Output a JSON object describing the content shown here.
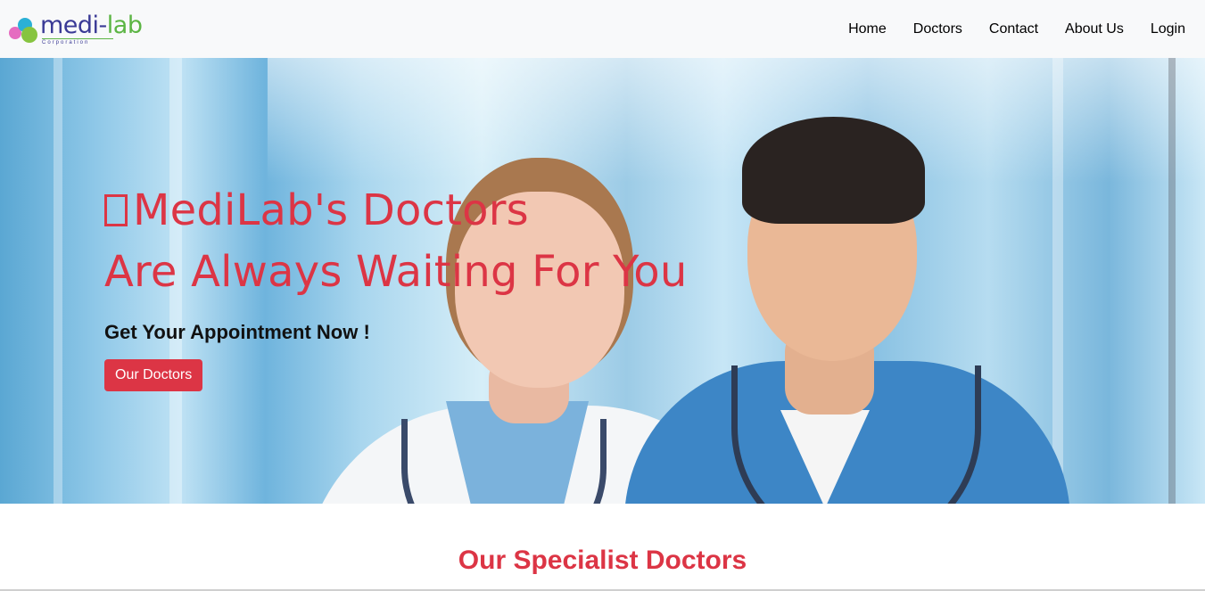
{
  "brand": {
    "name_part1": "medi-",
    "name_part2": "lab",
    "subtitle": "Corporation"
  },
  "nav": {
    "items": [
      {
        "label": "Home"
      },
      {
        "label": "Doctors"
      },
      {
        "label": "Contact"
      },
      {
        "label": "About Us"
      },
      {
        "label": "Login"
      }
    ]
  },
  "hero": {
    "title_line1": "MediLab's Doctors",
    "title_line2": "Are Always Waiting For You",
    "subtitle": "Get Your Appointment Now !",
    "button_label": "Our Doctors"
  },
  "section": {
    "title": "Our Specialist Doctors"
  },
  "colors": {
    "accent": "#dc3545",
    "navbar_bg": "#f8f9fa"
  }
}
